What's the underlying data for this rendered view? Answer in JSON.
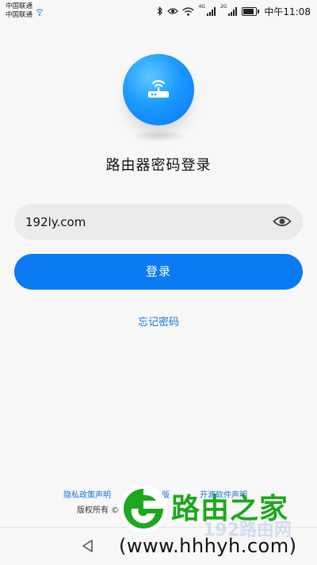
{
  "status_bar": {
    "carrier_1": "中国联通",
    "carrier_2": "中国联通",
    "net_4g": "4G",
    "net_2g": "2G",
    "battery_level": 0.85,
    "time": "中午11:08"
  },
  "login": {
    "title": "路由器密码登录",
    "password_value": "192ly.com",
    "login_label": "登录",
    "forgot_label": "忘记密码"
  },
  "footer": {
    "privacy_link": "隐私政策声明",
    "link_2": "用户版",
    "link_3": "开源软件声明",
    "copyright": "版权所有 ©"
  },
  "watermark": {
    "title": "路由之家",
    "faint_text": "192路由网",
    "url": "(www.hhhyh.com)"
  },
  "colors": {
    "accent": "#0a7af3",
    "link": "#1677d8",
    "watermark_green": "#1da81d",
    "watermark_red": "#d21f1f"
  },
  "icons": {
    "router": "router-icon",
    "eye": "eye-icon",
    "back": "back-icon"
  }
}
